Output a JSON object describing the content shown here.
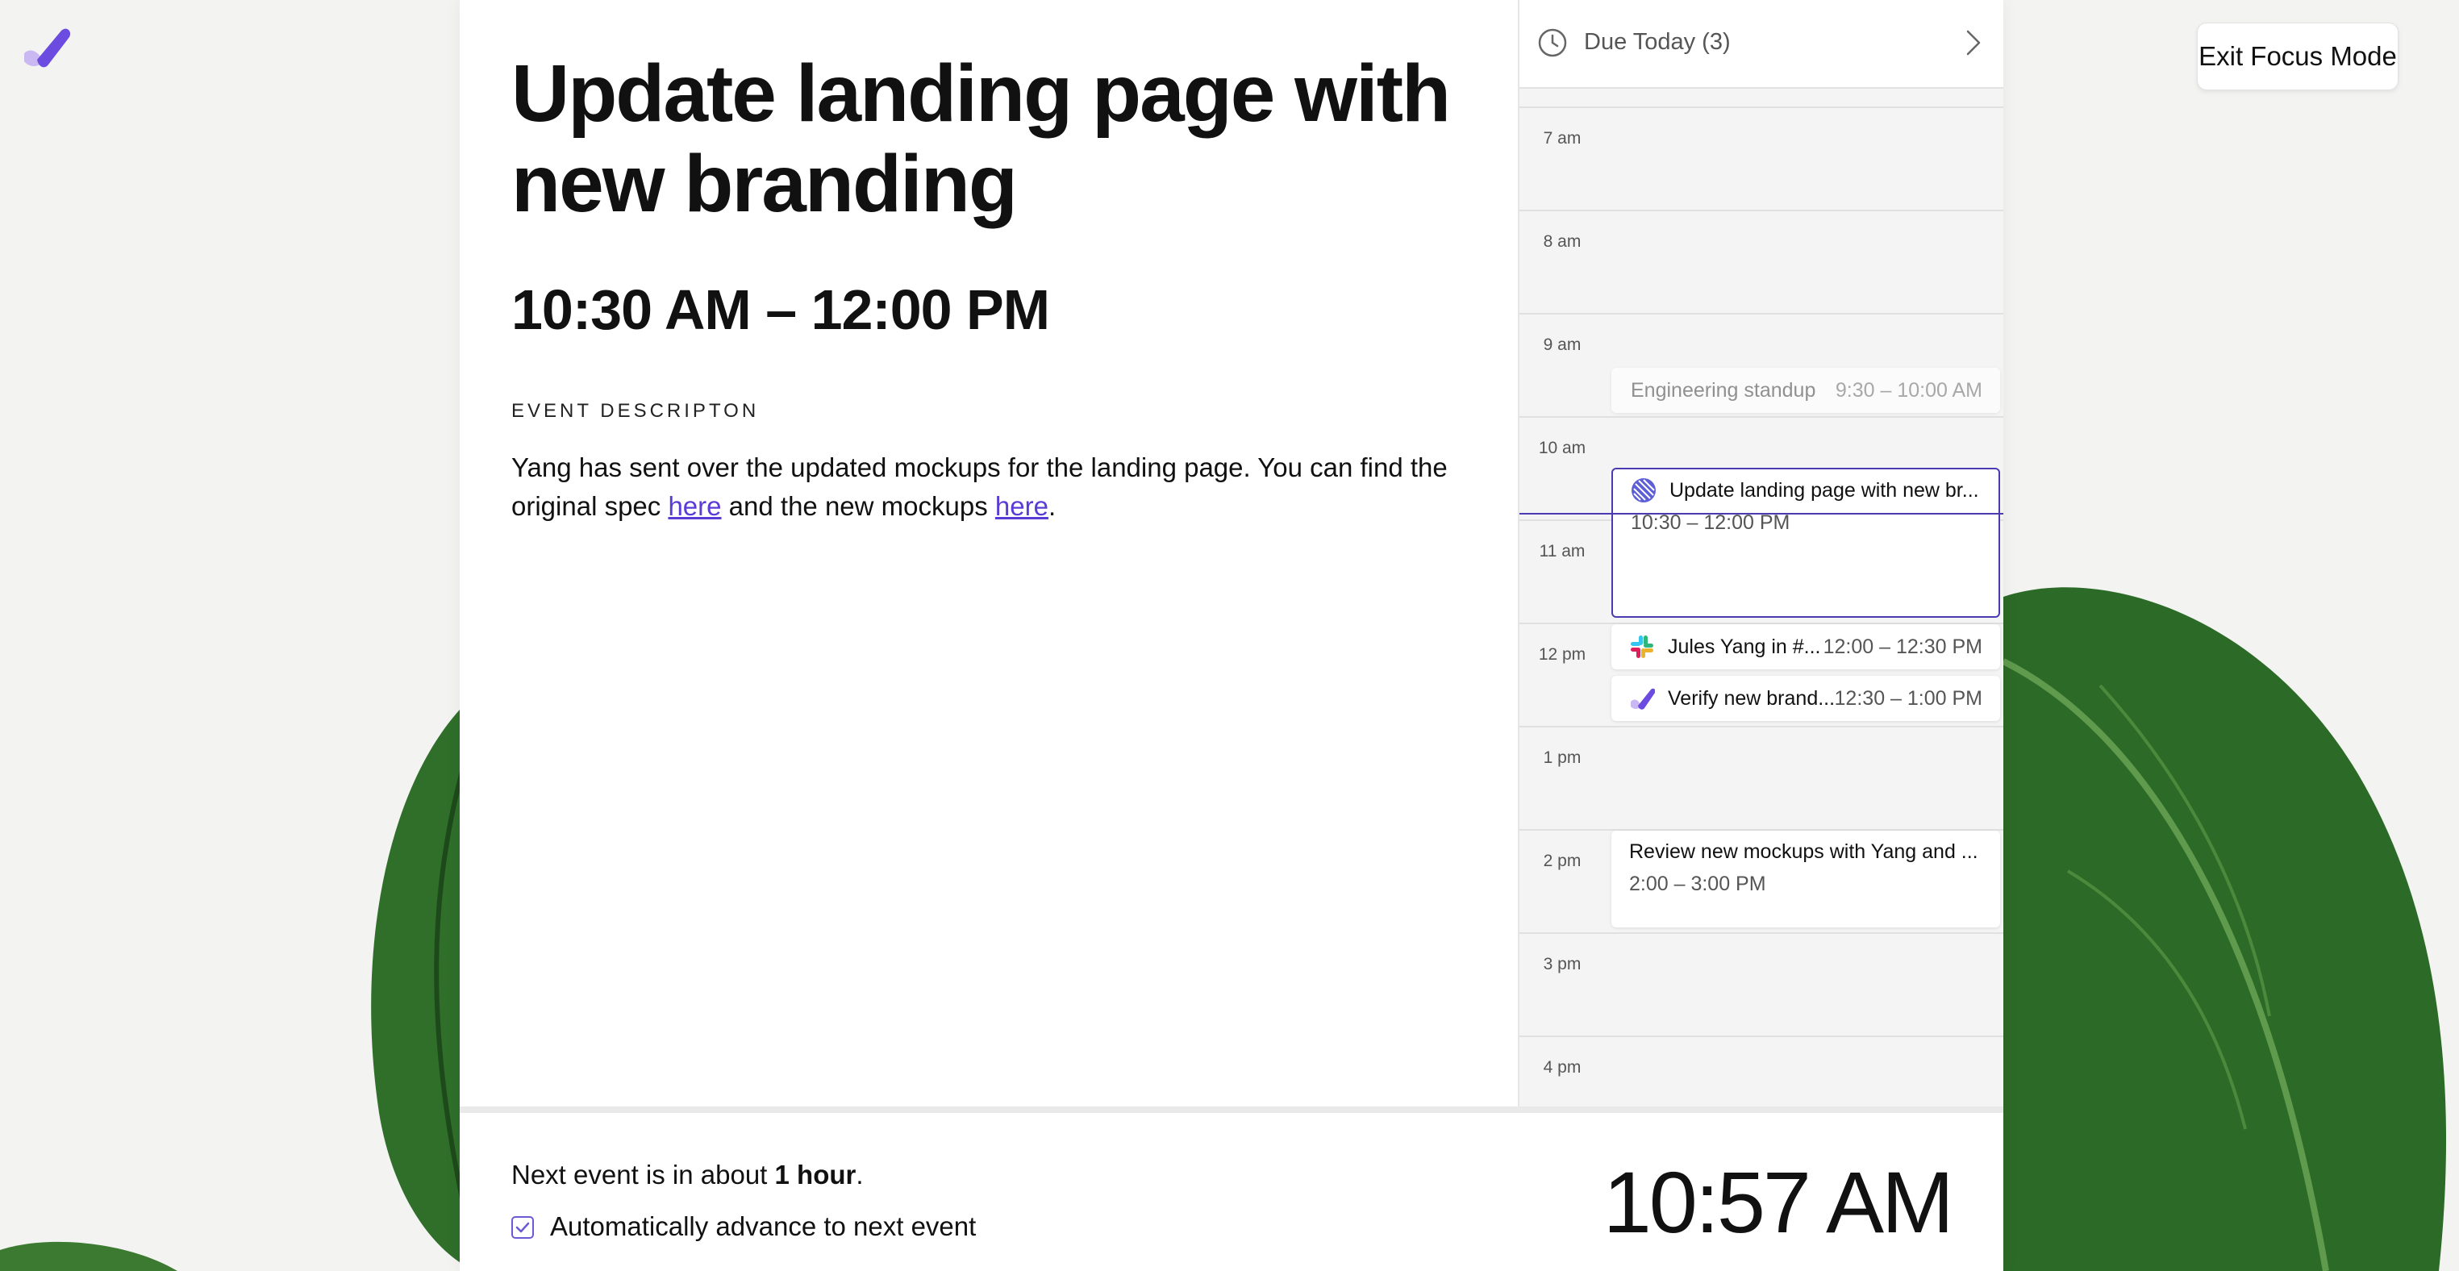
{
  "focus_button": {
    "label": "Exit Focus Mode"
  },
  "event": {
    "title": "Update landing page with new branding",
    "time_range": "10:30 AM – 12:00 PM",
    "description_heading": "EVENT DESCRIPTON",
    "description_part1": "Yang has sent over the updated mockups for the landing page. You can find the original spec ",
    "description_link1": "here",
    "description_part2": " and the new mockups ",
    "description_link2": "here",
    "description_part3": "."
  },
  "calendar": {
    "header_label": "Due Today (3)",
    "hours": [
      "7 am",
      "8 am",
      "9 am",
      "10 am",
      "11 am",
      "12 pm",
      "1 pm",
      "2 pm",
      "3 pm",
      "4 pm"
    ],
    "events": [
      {
        "title": "Engineering standup",
        "time": "9:30 – 10:00 AM"
      },
      {
        "title": "Update landing page with new br...",
        "time": "10:30 – 12:00 PM"
      },
      {
        "title": "Jules Yang in #...",
        "time": "12:00 – 12:30 PM"
      },
      {
        "title": "Verify new brand...",
        "time": "12:30 – 1:00 PM"
      },
      {
        "title": "Review new mockups with Yang and ...",
        "time": "2:00 – 3:00 PM"
      }
    ]
  },
  "footer": {
    "next_prefix": "Next event is in about ",
    "next_bold": "1 hour",
    "next_suffix": ".",
    "auto_advance_label": "Automatically advance to next event",
    "auto_advance_checked": true,
    "current_time": "10:57 AM"
  },
  "colors": {
    "accent": "#5a3bd6",
    "now_line": "#4a3bb0",
    "leaf_green": "#2f6f2a"
  }
}
